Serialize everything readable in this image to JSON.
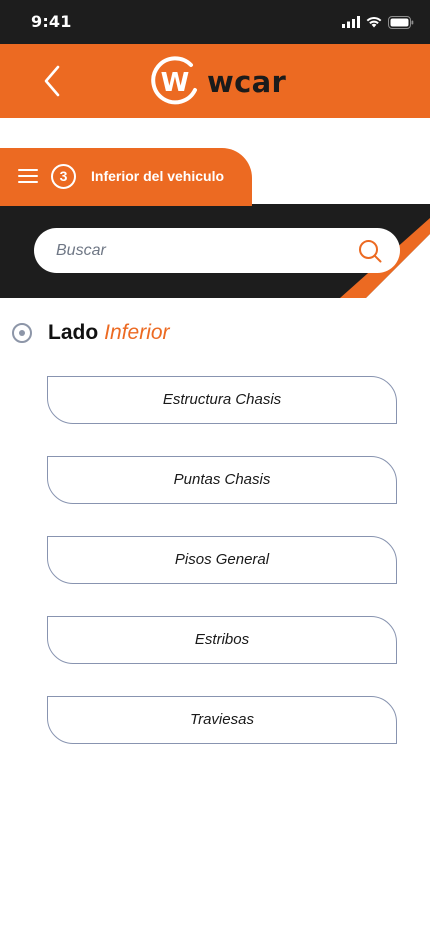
{
  "status_bar": {
    "time": "9:41"
  },
  "header": {
    "logo_text": "wcar",
    "logo_mark": "W"
  },
  "step": {
    "number": "3",
    "label": "Inferior del vehiculo"
  },
  "search": {
    "placeholder": "Buscar",
    "value": ""
  },
  "section": {
    "title_main": "Lado",
    "title_accent": "Inferior"
  },
  "options": [
    {
      "label": "Estructura Chasis"
    },
    {
      "label": "Puntas Chasis"
    },
    {
      "label": "Pisos General"
    },
    {
      "label": "Estribos"
    },
    {
      "label": "Traviesas"
    }
  ],
  "colors": {
    "accent": "#ec6a22",
    "dark": "#1d1d1d",
    "outline": "#8894b0"
  }
}
